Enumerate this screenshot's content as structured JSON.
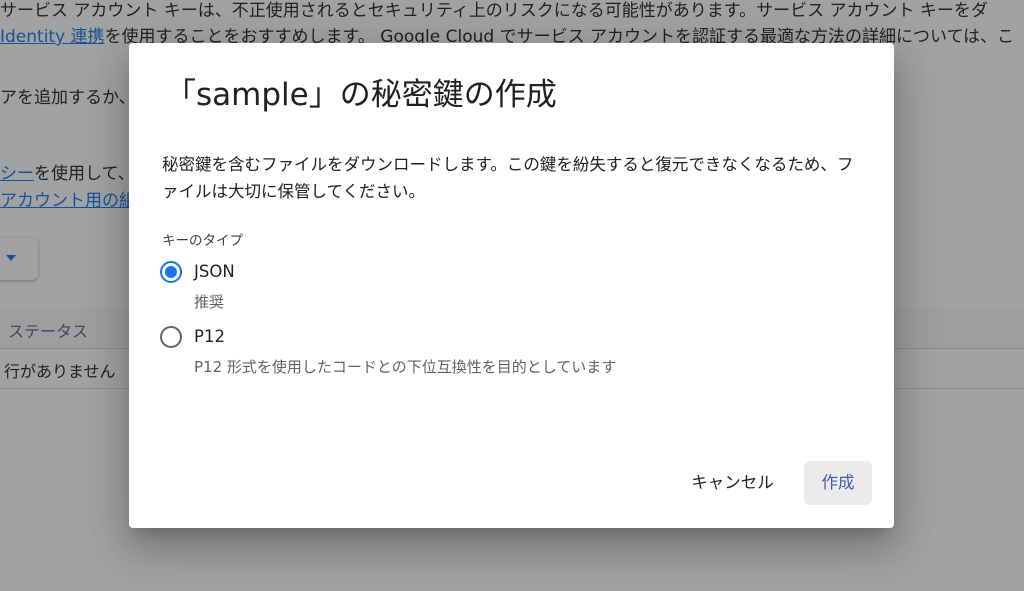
{
  "background": {
    "line1": "サービス アカウント キーは、不正使用されるとセキュリティ上のリスクになる可能性があります。サービス アカウント キーをダ",
    "line2_link": "Identity 連携",
    "line2_rest": "を使用することをおすすめします。 Google Cloud でサービス アカウントを認証する最適な方法の詳細については、こ",
    "frag_add": "アを追加するか、",
    "frag_policy_link": "シー",
    "frag_policy_rest": "を使用して、",
    "frag_account_link": "アカウント用の組",
    "table_header_status": "ステータス",
    "table_empty": "行がありません"
  },
  "dialog": {
    "title": "「sample」の秘密鍵の作成",
    "description": "秘密鍵を含むファイルをダウンロードします。この鍵を紛失すると復元できなくなるため、ファイルは大切に保管してください。",
    "key_type_label": "キーのタイプ",
    "options": [
      {
        "label": "JSON",
        "sublabel": "推奨",
        "selected": true
      },
      {
        "label": "P12",
        "sublabel": "P12 形式を使用したコードとの下位互換性を目的としています",
        "selected": false
      }
    ],
    "cancel_label": "キャンセル",
    "create_label": "作成"
  },
  "colors": {
    "accent": "#1a73e8",
    "create_button_bg": "#ebebed",
    "create_button_text": "#3c5da8"
  }
}
